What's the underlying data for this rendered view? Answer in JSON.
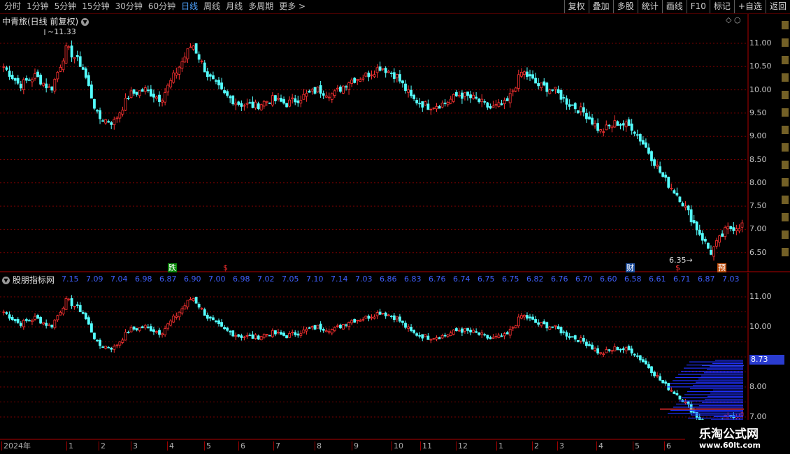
{
  "toolbar": {
    "tabs": [
      "分时",
      "1分钟",
      "5分钟",
      "15分钟",
      "30分钟",
      "60分钟",
      "日线",
      "周线",
      "月线",
      "多周期",
      "更多 >"
    ],
    "active_tab": "日线",
    "tools": [
      "复权",
      "叠加",
      "多股",
      "统计",
      "画线",
      "F10",
      "标记",
      "+自选",
      "返回"
    ]
  },
  "main_chart": {
    "title": "中青旅(日线 前复权)",
    "high_label": "11.33",
    "low_label": "6.35",
    "y_ticks": [
      "11.00",
      "10.50",
      "10.00",
      "9.50",
      "9.00",
      "8.50",
      "8.00",
      "7.50",
      "7.00",
      "6.50"
    ],
    "markers": [
      "跌",
      "$",
      "财",
      "$",
      "预"
    ]
  },
  "indicator": {
    "title": "股朋指标网",
    "values": [
      "7.15",
      "7.09",
      "7.04",
      "6.98",
      "6.87",
      "6.90",
      "7.00",
      "6.98",
      "7.02",
      "7.05",
      "7.10",
      "7.14",
      "7.03",
      "6.86",
      "6.83",
      "6.76",
      "6.74",
      "6.75",
      "6.75",
      "6.82",
      "6.76",
      "6.70",
      "6.60",
      "6.58",
      "6.61",
      "6.71",
      "6.87",
      "7.03"
    ],
    "y_ticks": [
      "11.00",
      "10.00",
      "8.00",
      "7.00"
    ],
    "current_price": "8.73"
  },
  "time_axis": {
    "months": [
      "2024年",
      "1",
      "2",
      "3",
      "4",
      "5",
      "6",
      "7",
      "8",
      "9",
      "10",
      "11",
      "12",
      "1",
      "2",
      "3",
      "4",
      "5",
      "6"
    ]
  },
  "watermark": {
    "name": "乐淘公式网",
    "url": "www.60lt.com"
  },
  "colors": {
    "up": "#ff3232",
    "down": "#54ffff",
    "grid": "#7a0000",
    "accent": "#2a3cd0"
  },
  "chart_data": {
    "type": "candlestick",
    "title": "中青旅(日线 前复权)",
    "ylim": [
      6.2,
      11.6
    ],
    "annotations": {
      "max": 11.33,
      "min": 6.35
    },
    "close_anchors": [
      10.5,
      10.1,
      10.3,
      10.0,
      10.9,
      10.5,
      9.4,
      9.3,
      9.9,
      10.0,
      9.8,
      10.4,
      11.0,
      10.3,
      9.9,
      9.7,
      9.65,
      9.8,
      9.7,
      9.85,
      10.0,
      9.9,
      10.2,
      10.3,
      10.5,
      10.3,
      9.8,
      9.65,
      9.7,
      9.9,
      9.8,
      9.6,
      9.7,
      10.4,
      10.1,
      10.0,
      9.7,
      9.5,
      9.1,
      9.3,
      9.2,
      8.7,
      8.1,
      7.7,
      7.1,
      6.5,
      7.0,
      7.1
    ]
  }
}
